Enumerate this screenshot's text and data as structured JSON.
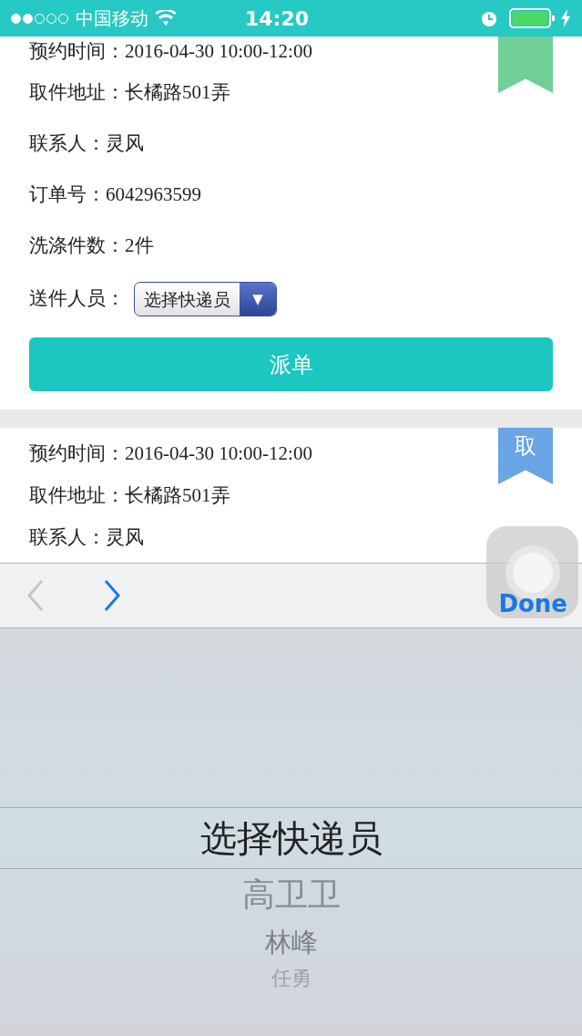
{
  "status_bar": {
    "carrier": "中国移动",
    "time": "14:20"
  },
  "orders": [
    {
      "color": "#6fcf97",
      "fields": [
        {
          "label": "预约时间：",
          "value": "2016-04-30 10:00-12:00"
        },
        {
          "label": "取件地址：",
          "value": "长橘路501弄"
        },
        {
          "label": "联系人：",
          "value": "灵风"
        },
        {
          "label": "订单号：",
          "value": "6042963599"
        },
        {
          "label": "洗涤件数：",
          "value": "2件"
        }
      ],
      "courier": {
        "label": "送件人员：",
        "value": "选择快递员",
        "arrow": "▼"
      },
      "action": "派单"
    },
    {
      "color": "#6aa5e6",
      "badge_text": "取",
      "fields": [
        {
          "label": "预约时间：",
          "value": "2016-04-30 10:00-12:00"
        },
        {
          "label": "取件地址：",
          "value": "长橘路501弄"
        },
        {
          "label": "联系人：",
          "value": "灵风"
        }
      ]
    }
  ],
  "keyboard_toolbar": {
    "previous_disabled": true,
    "next_disabled": false,
    "done": "Done"
  },
  "picker": [
    {
      "label": "选择快递员",
      "selected": true
    },
    {
      "label": "高卫卫",
      "selected": false
    },
    {
      "label": "林峰",
      "selected": false
    },
    {
      "label": "任勇",
      "selected": false
    }
  ]
}
